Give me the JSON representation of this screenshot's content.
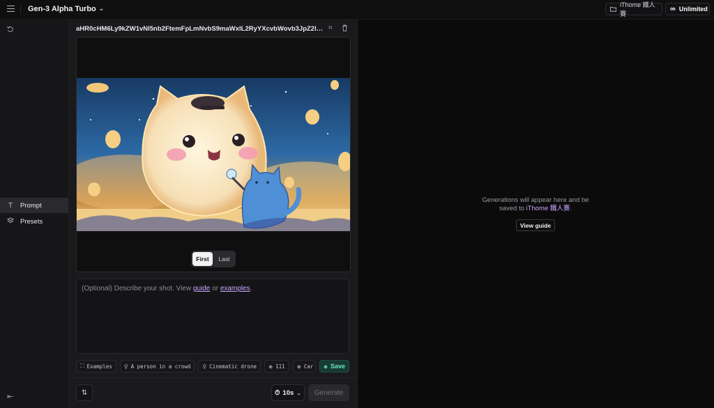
{
  "header": {
    "model": "Gen-3 Alpha Turbo",
    "folder": "iThome 鐵人賽",
    "plan": "Unlimited"
  },
  "sidebar": {
    "items": [
      {
        "label": "Prompt",
        "icon": "text-t-icon"
      },
      {
        "label": "Presets",
        "icon": "layers-icon"
      }
    ]
  },
  "editor": {
    "filename": "aHR0cHM6Ly9kZW1vNl5nb2FtemFpLmNvbS9maWxlL2RyYXcvbWovb3JpZ2luLzk0NWRjMz...",
    "frame_toggle": {
      "first": "First",
      "last": "Last",
      "selected": "First"
    },
    "prompt": {
      "placeholder_a": "(Optional) Describe your shot. View ",
      "link_guide": "guide",
      "or": " or ",
      "link_examples": "examples",
      "end": "."
    },
    "chips": [
      "Examples",
      "A person in a crowd",
      "Cinematic drone",
      "111",
      "Car"
    ],
    "save": "Save",
    "duration": "10s",
    "generate": "Generate"
  },
  "empty_state": {
    "line1": "Generations will appear here and be",
    "line2_a": "saved to ",
    "line2_hl": "iThome 鐵人賽",
    "line2_b": ".",
    "button": "View guide"
  },
  "colors": {
    "accent_purple": "#c9a6ff",
    "save_green": "#6ee7c3"
  }
}
